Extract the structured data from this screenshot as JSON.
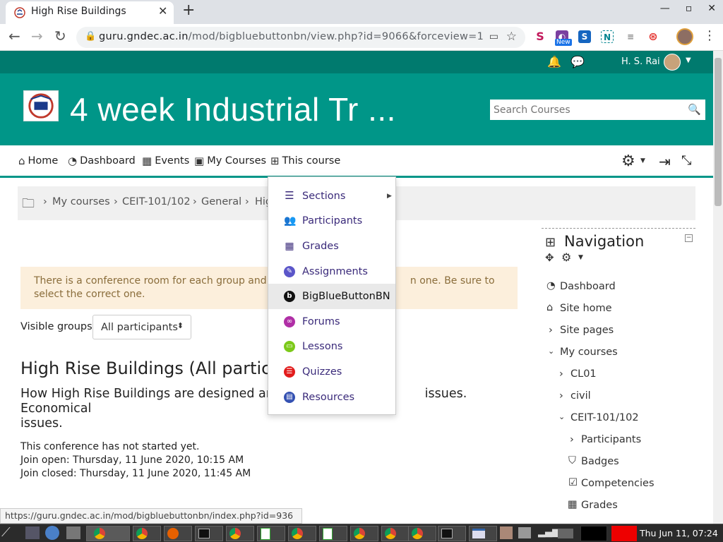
{
  "browser": {
    "tab_title": "High Rise Buildings",
    "new_tab_label": "+",
    "url_host": "guru.gndec.ac.in",
    "url_path": "/mod/bigbluebuttonbn/view.php?id=9066&forceview=1",
    "ext_new_badge": "New"
  },
  "topbar": {
    "user_name": "H. S. Rai"
  },
  "header": {
    "course_title": "4 week Industrial Tr ...",
    "search_placeholder": "Search Courses"
  },
  "main_nav": {
    "home": "Home",
    "dashboard": "Dashboard",
    "events": "Events",
    "my_courses": "My Courses",
    "this_course": "This course"
  },
  "breadcrumb": {
    "items": [
      "My courses",
      "CEIT-101/102",
      "General",
      "Hig"
    ]
  },
  "dropdown": {
    "items": [
      {
        "label": "Sections",
        "icon": "list-icon",
        "color": "#3a2a7a"
      },
      {
        "label": "Participants",
        "icon": "users-icon",
        "color": "#3a2a7a"
      },
      {
        "label": "Grades",
        "icon": "table-icon",
        "color": "#3a2a7a"
      },
      {
        "label": "Assignments",
        "icon": "assignment-icon",
        "color": "#5b56c9"
      },
      {
        "label": "BigBlueButtonBN",
        "icon": "bigbluebutton-icon",
        "color": "#111111"
      },
      {
        "label": "Forums",
        "icon": "forum-icon",
        "color": "#b02fa6"
      },
      {
        "label": "Lessons",
        "icon": "lesson-icon",
        "color": "#7cc91a"
      },
      {
        "label": "Quizzes",
        "icon": "quiz-icon",
        "color": "#e21c1c"
      },
      {
        "label": "Resources",
        "icon": "resource-icon",
        "color": "#3451b2"
      }
    ]
  },
  "content": {
    "alert_text_a": "There is a conference room for each group and yo",
    "alert_text_b": "n one. Be sure to",
    "alert_text_c": "select the correct one.",
    "visible_groups_label": "Visible groups",
    "visible_groups_value": "All participants",
    "heading": "High Rise Buildings (All particip",
    "desc_a": "How High Rise Buildings are designed and b",
    "desc_b": "issues. Economical",
    "desc_c": "issues.",
    "status_line": "This conference has not started yet.",
    "join_open": "Join open: Thursday, 11 June 2020, 10:15 AM",
    "join_closed": "Join closed: Thursday, 11 June 2020, 11:45 AM"
  },
  "navigation": {
    "title": "Navigation",
    "items": [
      {
        "label": "Dashboard"
      },
      {
        "label": "Site home"
      },
      {
        "label": "Site pages"
      },
      {
        "label": "My courses"
      },
      {
        "label": "CL01"
      },
      {
        "label": "civil"
      },
      {
        "label": "CEIT-101/102"
      },
      {
        "label": "Participants"
      },
      {
        "label": "Badges"
      },
      {
        "label": "Competencies"
      },
      {
        "label": "Grades"
      }
    ]
  },
  "status_bar": {
    "text": "https://guru.gndec.ac.in/mod/bigbluebuttonbn/index.php?id=936"
  },
  "taskbar": {
    "clock": "Thu Jun 11, 07:24"
  },
  "colors": {
    "brand": "#009688",
    "brand_dark": "#007a6e",
    "alert_bg": "#fcefdc"
  }
}
